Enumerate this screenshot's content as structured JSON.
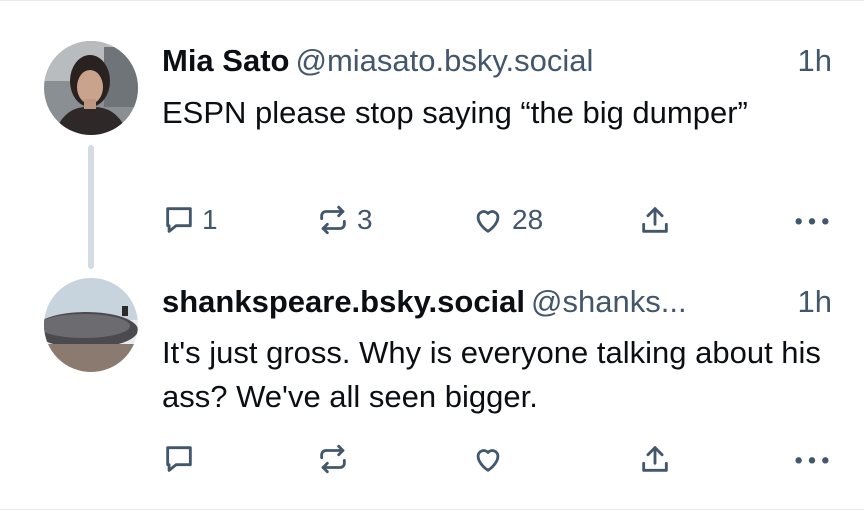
{
  "posts": [
    {
      "display_name": "Mia Sato",
      "handle": "@miasato.bsky.social",
      "time": "1h",
      "text": "ESPN please stop saying “the big dumper”",
      "replies": "1",
      "reposts": "3",
      "likes": "28"
    },
    {
      "display_name": "shankspeare.bsky.social",
      "handle": "@shanks...",
      "time": "1h",
      "text": "It's just gross. Why is everyone talking about his ass? We've all seen bigger.",
      "replies": "",
      "reposts": "",
      "likes": ""
    }
  ],
  "icons": {
    "reply": "speech-bubble-icon",
    "repost": "repost-arrows-icon",
    "like": "heart-icon",
    "share": "share-upload-icon",
    "more": "ellipsis-icon"
  },
  "colors": {
    "text": "#0b0f14",
    "muted": "#42576c",
    "thread_line": "#d4dbe2"
  }
}
